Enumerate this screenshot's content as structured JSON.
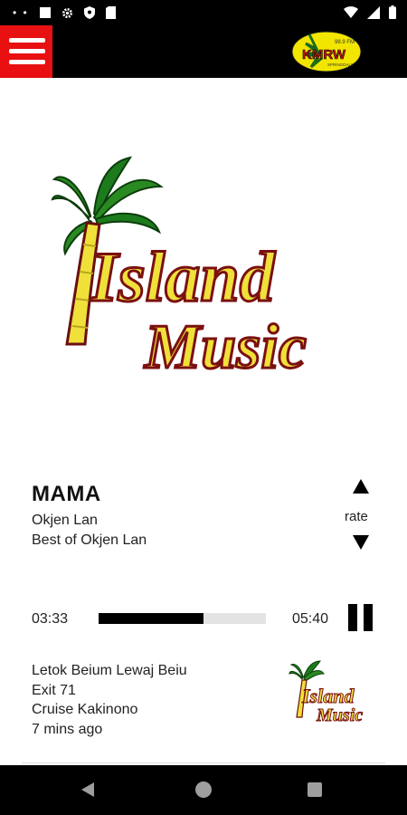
{
  "app": {
    "station_logo_text": "KMRW",
    "station_logo_freq": "98.9 FM",
    "station_logo_sub": "SPRINGDALE"
  },
  "artwork": {
    "line1": "Island",
    "line2": "Music"
  },
  "now_playing": {
    "title": "MAMA",
    "artist": "Okjen Lan",
    "album": "Best of Okjen Lan",
    "rate_label": "rate"
  },
  "player": {
    "elapsed": "03:33",
    "total": "05:40",
    "progress": 0.625
  },
  "recent": {
    "title": "Letok Beium Lewaj Beiu",
    "artist": "Exit 71",
    "album": "Cruise Kakinono",
    "time_ago": "7 mins ago",
    "thumb_line1": "Island",
    "thumb_line2": "Music"
  },
  "colors": {
    "menu_red": "#e81010",
    "logo_yellow": "#f2e600",
    "palm_green": "#1d7a1d",
    "trunk_yellow": "#f0e03a",
    "text_red": "#7a1010"
  }
}
